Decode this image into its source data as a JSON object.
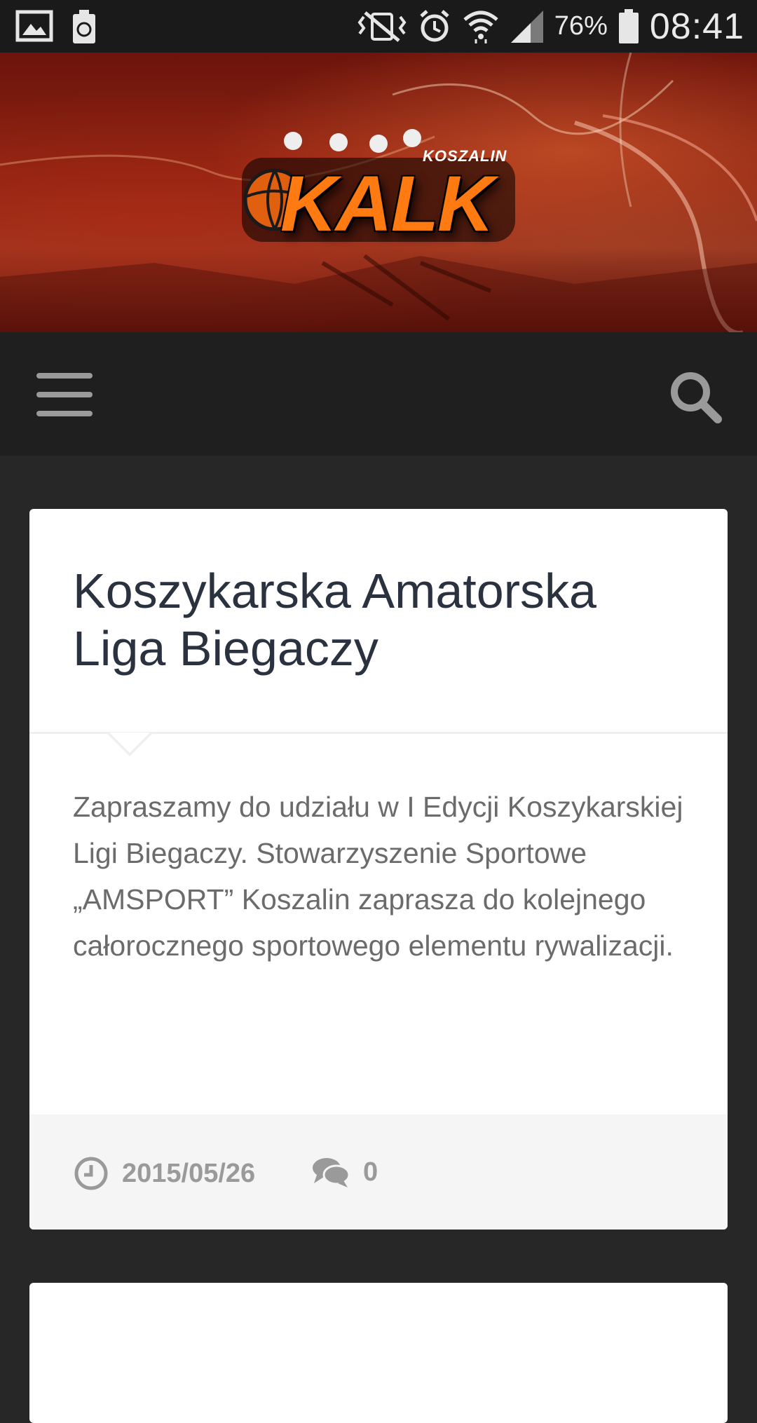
{
  "status_bar": {
    "battery_percent": "76%",
    "time": "08:41",
    "icons": [
      "image-icon",
      "recycle-icon",
      "vibrate-off-icon",
      "alarm-icon",
      "wifi-icon",
      "signal-icon",
      "battery-icon"
    ]
  },
  "header": {
    "logo_small_text": "KOSZALIN",
    "logo_main_text": "KALK"
  },
  "navbar": {
    "menu_icon": "hamburger-menu-icon",
    "search_icon": "search-icon"
  },
  "post": {
    "title": "Koszykarska Amatorska Liga Biegaczy",
    "excerpt": "Zapraszamy do udziału w I Edycji Koszykarskiej Ligi Biegaczy. Stowarzyszenie Sportowe „AMSPORT” Koszalin zaprasza do kolejnego całorocznego sportowego elementu rywalizacji.",
    "date": "2015/05/26",
    "comments": "0"
  },
  "next_post": {
    "title_partial": ""
  },
  "colors": {
    "page_bg": "#272727",
    "navbar_bg": "#1f1f1f",
    "card_title": "#2a3240",
    "logo_orange": "#ff7a10"
  }
}
